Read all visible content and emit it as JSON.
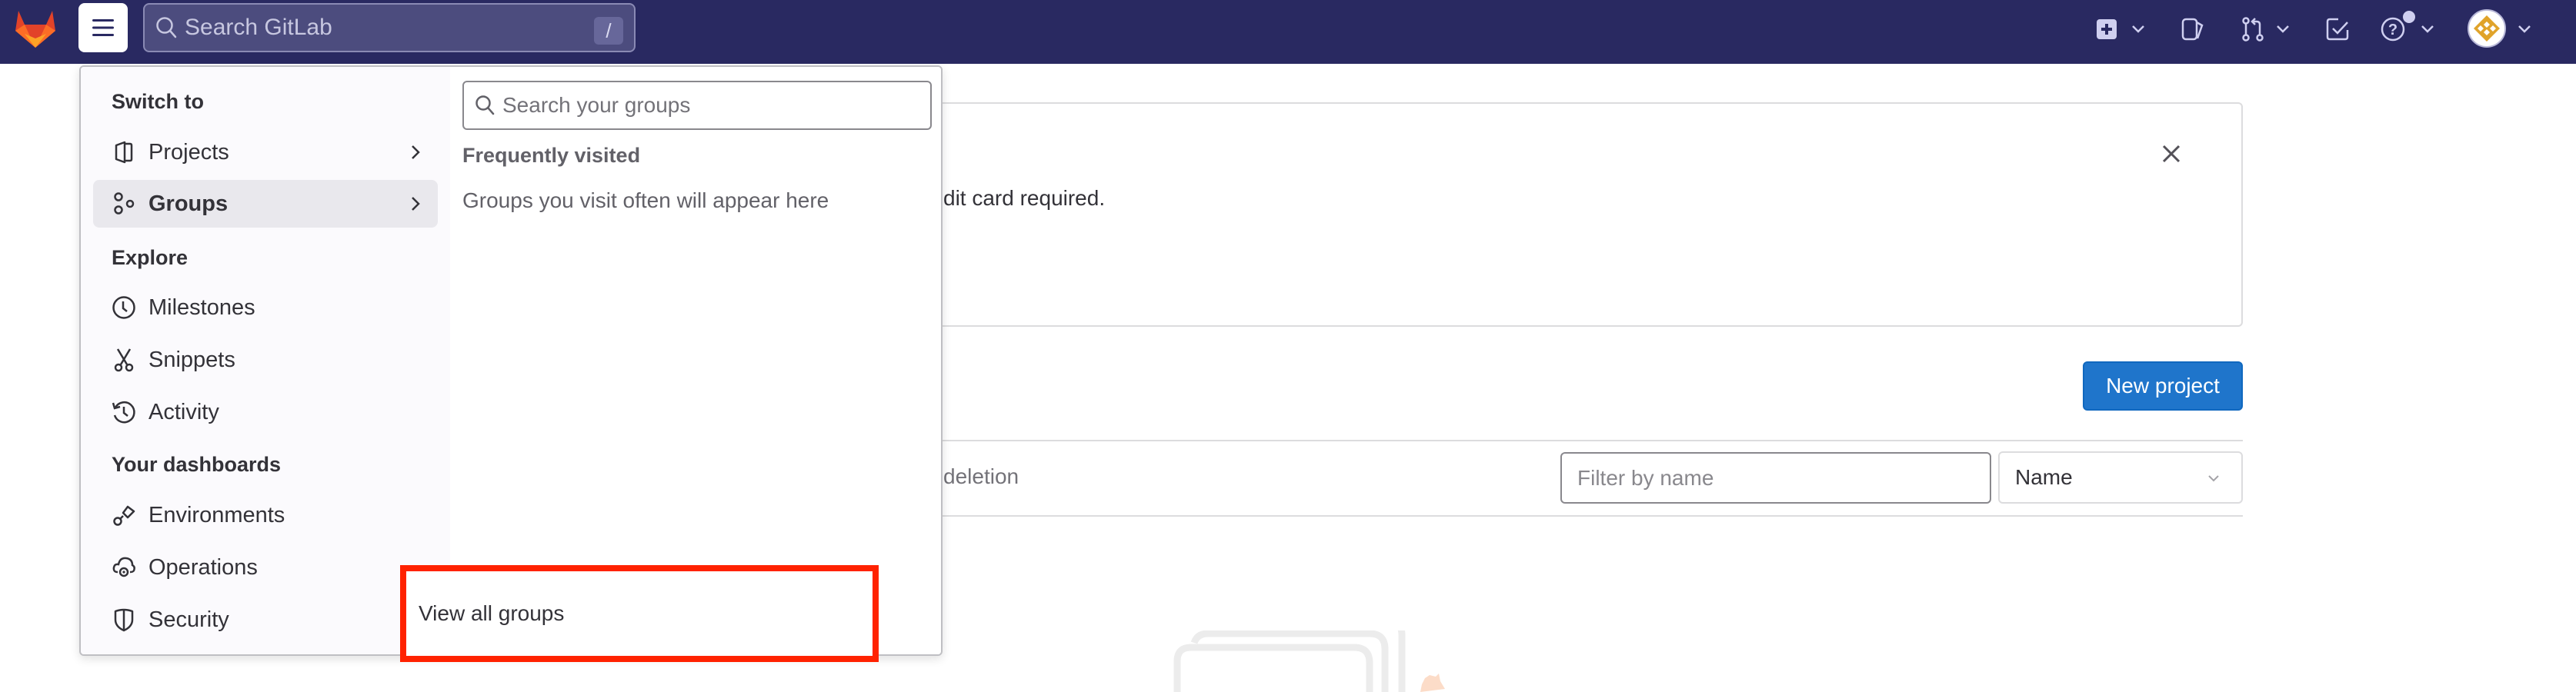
{
  "header": {
    "search_placeholder": "Search GitLab",
    "search_shortcut": "/",
    "icons": [
      "gitlab-logo",
      "hamburger-menu-icon",
      "search-icon",
      "create-new-icon",
      "issues-icon",
      "merge-requests-icon",
      "todos-icon",
      "help-icon",
      "user-avatar"
    ]
  },
  "dropdown": {
    "left": {
      "sections": [
        {
          "title": "Switch to",
          "items": [
            {
              "label": "Projects",
              "icon": "project-icon",
              "has_chevron": true,
              "active": false
            },
            {
              "label": "Groups",
              "icon": "group-icon",
              "has_chevron": true,
              "active": true
            }
          ]
        },
        {
          "title": "Explore",
          "items": [
            {
              "label": "Milestones",
              "icon": "clock-icon"
            },
            {
              "label": "Snippets",
              "icon": "snippet-icon"
            },
            {
              "label": "Activity",
              "icon": "history-icon"
            }
          ]
        },
        {
          "title": "Your dashboards",
          "items": [
            {
              "label": "Environments",
              "icon": "environment-icon"
            },
            {
              "label": "Operations",
              "icon": "cloud-gear-icon"
            },
            {
              "label": "Security",
              "icon": "shield-icon"
            }
          ]
        }
      ]
    },
    "right": {
      "search_placeholder": "Search your groups",
      "frequent_title": "Frequently visited",
      "frequent_empty": "Groups you visit often will appear here",
      "view_all": "View all groups"
    }
  },
  "page": {
    "banner_text": "dit card required.",
    "new_project_label": "New project",
    "tab_partial": "deletion",
    "filter_placeholder": "Filter by name",
    "sort_selected": "Name"
  },
  "colors": {
    "header_bg": "#292961",
    "primary_button": "#1f75cb",
    "highlight_box": "#ff2200"
  }
}
